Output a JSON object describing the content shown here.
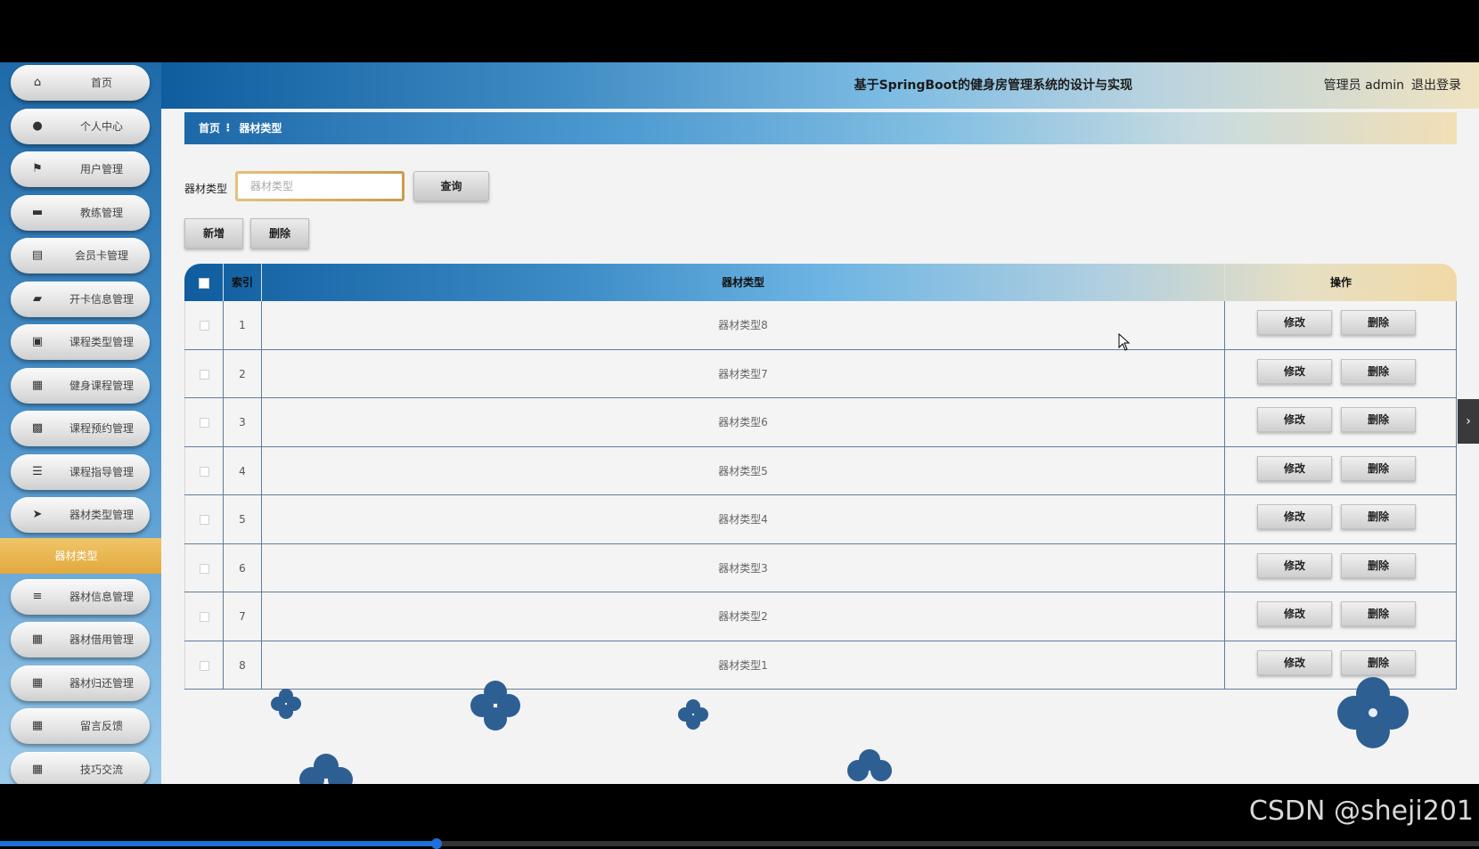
{
  "header": {
    "title": "基于SpringBoot的健身房管理系统的设计与实现",
    "user_label": "管理员 admin",
    "logout_label": "退出登录"
  },
  "sidebar": {
    "items": [
      {
        "label": "首页",
        "icon": "home-icon"
      },
      {
        "label": "个人中心",
        "icon": "user-icon"
      },
      {
        "label": "用户管理",
        "icon": "flag-icon"
      },
      {
        "label": "教练管理",
        "icon": "monitor-icon"
      },
      {
        "label": "会员卡管理",
        "icon": "card-icon"
      },
      {
        "label": "开卡信息管理",
        "icon": "briefcase-icon"
      },
      {
        "label": "课程类型管理",
        "icon": "clipboard-icon"
      },
      {
        "label": "健身课程管理",
        "icon": "grid-icon"
      },
      {
        "label": "课程预约管理",
        "icon": "calendar-icon"
      },
      {
        "label": "课程指导管理",
        "icon": "list-icon"
      },
      {
        "label": "器材类型管理",
        "icon": "send-icon"
      }
    ],
    "active_sub": "器材类型",
    "items_after": [
      {
        "label": "器材信息管理",
        "icon": "sliders-icon"
      },
      {
        "label": "器材借用管理",
        "icon": "grid-icon"
      },
      {
        "label": "器材归还管理",
        "icon": "grid-icon"
      },
      {
        "label": "留言反馈",
        "icon": "grid-icon"
      },
      {
        "label": "技巧交流",
        "icon": "grid-icon"
      }
    ]
  },
  "breadcrumb": {
    "home": "首页",
    "separator": "⠇",
    "current": "器材类型"
  },
  "search": {
    "label": "器材类型",
    "placeholder": "器材类型",
    "value": "",
    "query_label": "查询"
  },
  "toolbar": {
    "add_label": "新增",
    "delete_label": "删除"
  },
  "table": {
    "columns": {
      "index": "索引",
      "type": "器材类型",
      "actions": "操作"
    },
    "edit_label": "修改",
    "delete_label": "删除",
    "rows": [
      {
        "index": "1",
        "type": "器材类型8"
      },
      {
        "index": "2",
        "type": "器材类型7"
      },
      {
        "index": "3",
        "type": "器材类型6"
      },
      {
        "index": "4",
        "type": "器材类型5"
      },
      {
        "index": "5",
        "type": "器材类型4"
      },
      {
        "index": "6",
        "type": "器材类型3"
      },
      {
        "index": "7",
        "type": "器材类型2"
      },
      {
        "index": "8",
        "type": "器材类型1"
      }
    ]
  },
  "watermark": "CSDN @sheji201",
  "video": {
    "progress": 0.295
  },
  "colors": {
    "accent_blue": "#1f6aa8",
    "accent_gold": "#e2a93e",
    "flower": "#2d5f93"
  }
}
